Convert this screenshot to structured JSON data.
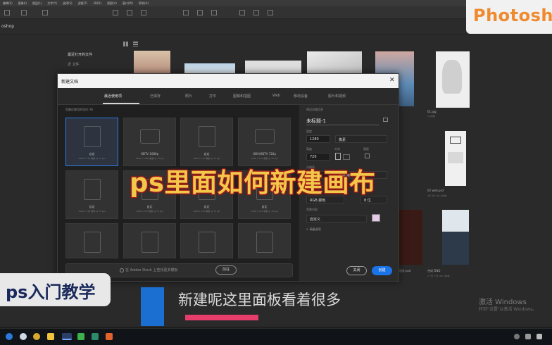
{
  "menu": [
    "编辑(E)",
    "图像(I)",
    "图层(L)",
    "文字(Y)",
    "选择(S)",
    "滤镜(T)",
    "3D(D)",
    "视图(V)",
    "窗口(W)",
    "帮助(H)"
  ],
  "app_tab_title": "oshop",
  "brand_watermark": "Photosho",
  "start_screen": {
    "recent_label": "最近打开的文件",
    "recent_sub": "近 文件",
    "thumbs": [
      {
        "caption": "01.jpg",
        "meta": "1小时前"
      },
      {
        "caption": "02 web.psd",
        "meta": "4天 3天 100 小时前"
      },
      {
        "caption": "设计.psd"
      },
      {
        "caption": "合成 DND",
        "meta": "1个月 个月 100 小时前"
      }
    ]
  },
  "dialog": {
    "title": "新建文档",
    "close_glyph": "✕",
    "tabs": [
      {
        "label": "最近使用项",
        "active": true
      },
      {
        "label": "已保存",
        "active": false
      },
      {
        "label": "照片",
        "active": false
      },
      {
        "label": "打印",
        "active": false
      },
      {
        "label": "图稿和插图",
        "active": false
      },
      {
        "label": "Web",
        "active": false
      },
      {
        "label": "移动设备",
        "active": false
      },
      {
        "label": "胶片和视频",
        "active": false
      }
    ],
    "presets_title": "您最近使用的项目 (9)",
    "presets": [
      {
        "name": "自定",
        "size": "1240 x 720 像素 @ 72 ppi",
        "type": "doc",
        "selected": true
      },
      {
        "name": "HDTV 1080p",
        "size": "1920 x 1080 像素 @ 72 ppi",
        "type": "video",
        "selected": false
      },
      {
        "name": "自定",
        "size": "1920 x 720 像素 @ 72 ppi",
        "type": "doc",
        "selected": false
      },
      {
        "name": "HDV/HDTV 720p",
        "size": "1280 x 720 像素 @ 72 ppi",
        "type": "video",
        "selected": false
      },
      {
        "name": "自定",
        "size": "1240 x 720 像素 @ 72 ppi",
        "type": "doc",
        "selected": false
      },
      {
        "name": "自定",
        "size": "1920 x 720 像素 @ 72 ppi",
        "type": "doc",
        "selected": false
      },
      {
        "name": "自定",
        "size": "1920 x 720 像素 @ 72 ppi",
        "type": "doc",
        "selected": false
      },
      {
        "name": "自定",
        "size": "1920 x 720 像素 @ 72 ppi",
        "type": "doc",
        "selected": false
      },
      {
        "name": "",
        "size": "",
        "type": "doc",
        "selected": false
      },
      {
        "name": "",
        "size": "",
        "type": "doc",
        "selected": false
      },
      {
        "name": "",
        "size": "",
        "type": "doc",
        "selected": false
      },
      {
        "name": "",
        "size": "",
        "type": "doc",
        "selected": false
      }
    ],
    "search_placeholder": "在 Adobe Stock 上查找更多模板",
    "search_button": "前往",
    "details": {
      "heading": "预设详细信息",
      "doc_name": "未标题-1",
      "width_label": "宽度",
      "width_value": "1280",
      "width_unit": "像素",
      "height_label": "高度",
      "height_value": "720",
      "orientation_label": "方向",
      "artboard_label": "画板",
      "resolution_label": "分辨率",
      "resolution_value": "72",
      "resolution_unit": "像素/英寸",
      "color_mode_label": "颜色模式",
      "color_mode_value": "RGB 颜色",
      "bit_depth": "8 位",
      "background_label": "背景内容",
      "background_value": "自定义",
      "background_color": "#e6c9e6",
      "advanced_label": "> 高级选项"
    },
    "close_button": "关闭",
    "create_button": "创建"
  },
  "overlay": {
    "big_caption": "ps里面如何新建画布",
    "tag": "ps入门教学",
    "subtitle": "新建呢这里面板看着很多"
  },
  "activate_windows": {
    "title": "激活 Windows",
    "sub": "转到\"设置\"以激活 Windows。"
  },
  "colors": {
    "accent_blue": "#1a74e8",
    "caption_yellow": "#f2c84b",
    "caption_outline": "#b51b1b",
    "brand_orange": "#f08a2e",
    "pink_bar": "#e63d6a"
  }
}
